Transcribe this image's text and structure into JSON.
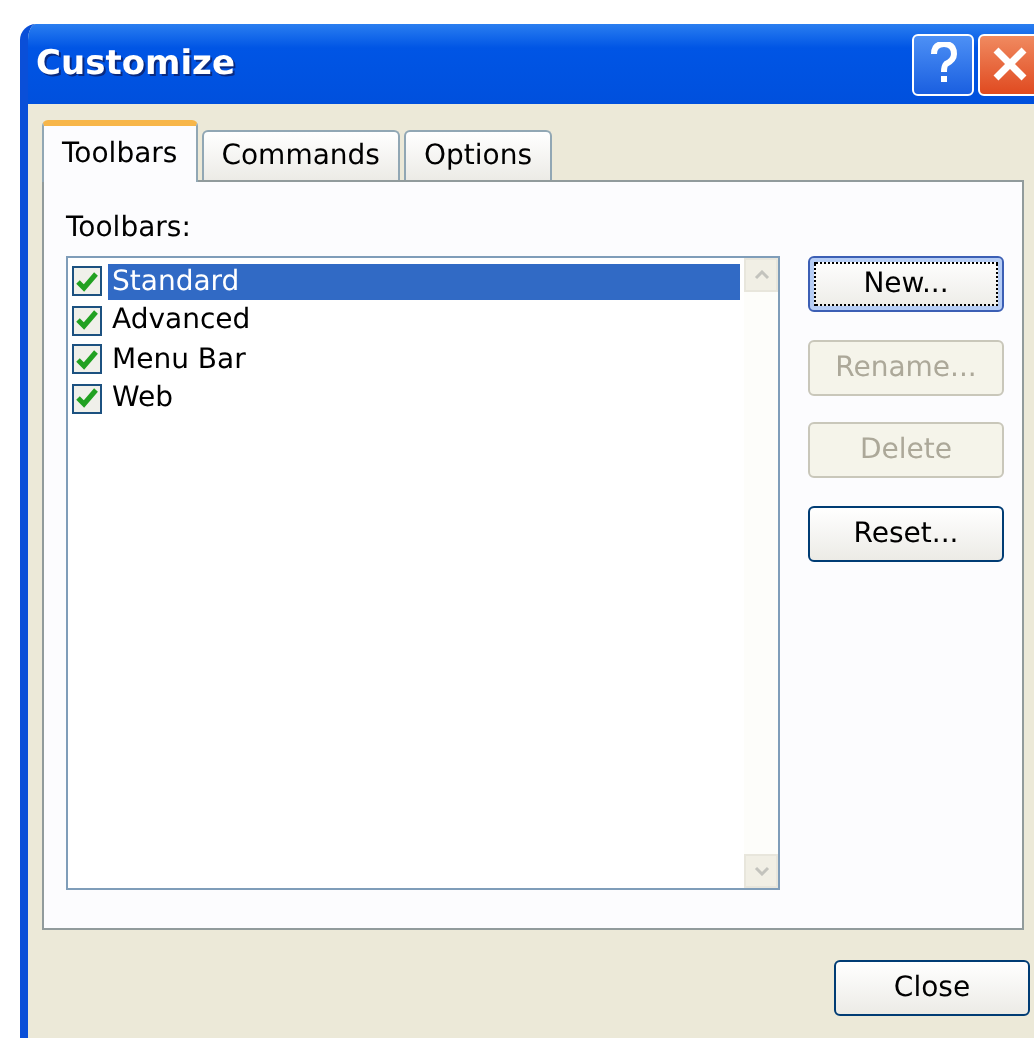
{
  "window": {
    "title": "Customize"
  },
  "tabs": [
    {
      "label": "Toolbars",
      "selected": true
    },
    {
      "label": "Commands",
      "selected": false
    },
    {
      "label": "Options",
      "selected": false
    }
  ],
  "toolbars_label": "Toolbars:",
  "toolbars": [
    {
      "name": "Standard",
      "checked": true,
      "selected": true
    },
    {
      "name": "Advanced",
      "checked": true,
      "selected": false
    },
    {
      "name": "Menu Bar",
      "checked": true,
      "selected": false
    },
    {
      "name": "Web",
      "checked": true,
      "selected": false
    }
  ],
  "buttons": [
    {
      "label": "New...",
      "disabled": false,
      "focused": true
    },
    {
      "label": "Rename...",
      "disabled": true,
      "focused": false
    },
    {
      "label": "Delete",
      "disabled": true,
      "focused": false
    },
    {
      "label": "Reset...",
      "disabled": false,
      "focused": false
    }
  ],
  "close_button": "Close"
}
